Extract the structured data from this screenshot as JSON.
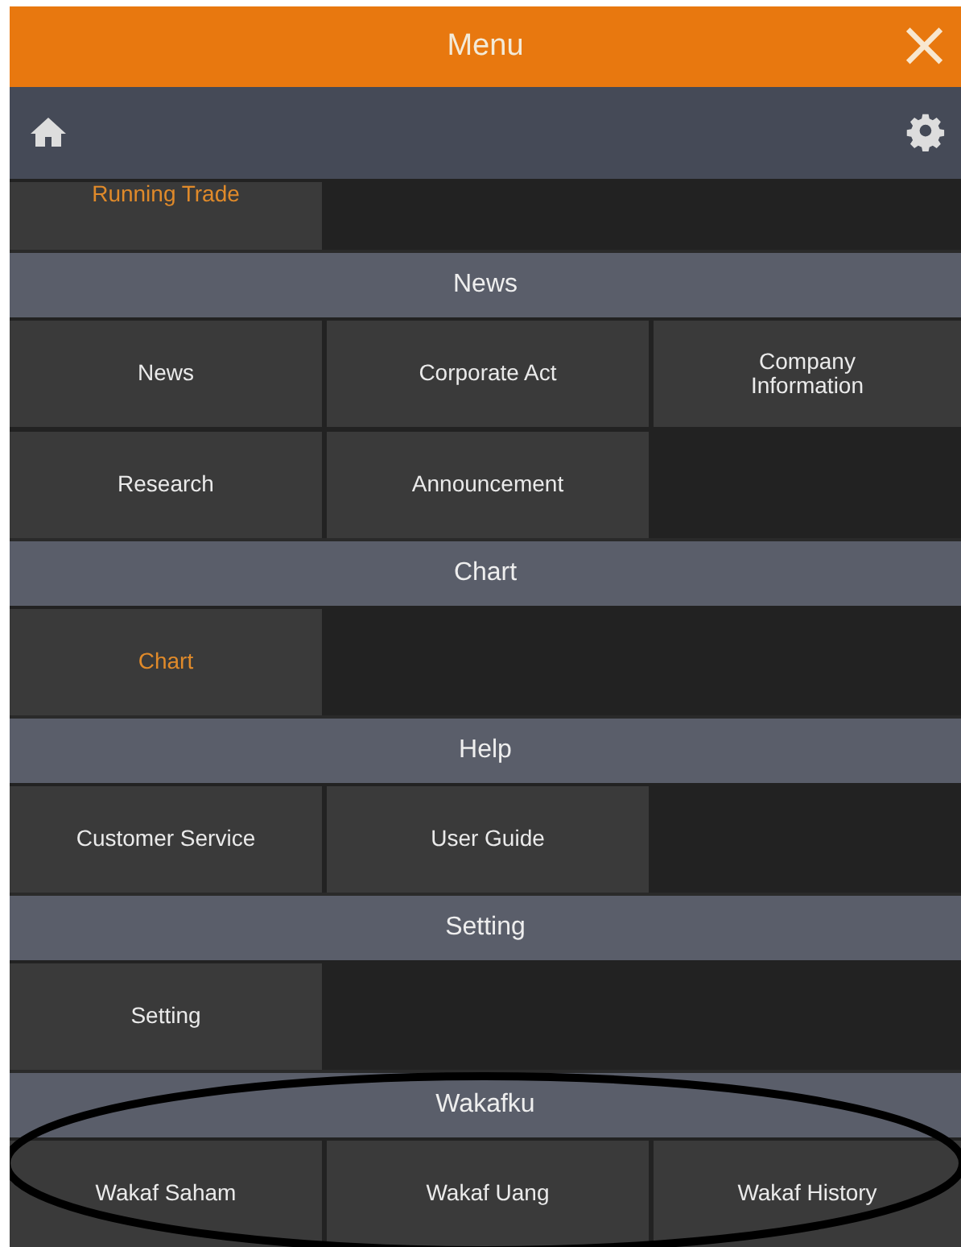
{
  "header": {
    "title": "Menu",
    "close": "×"
  },
  "sections": [
    {
      "circled": false,
      "items": [
        {
          "label": "Running Trade",
          "selected": true
        }
      ]
    },
    {
      "title": "News",
      "circled": false,
      "items": [
        {
          "label": "News",
          "selected": false
        },
        {
          "label": "Corporate Act",
          "selected": false
        },
        {
          "label": "Company Information",
          "selected": false
        },
        {
          "label": "Research",
          "selected": false
        },
        {
          "label": "Announcement",
          "selected": false
        }
      ]
    },
    {
      "title": "Chart",
      "circled": false,
      "items": [
        {
          "label": "Chart",
          "selected": true
        }
      ]
    },
    {
      "title": "Help",
      "circled": false,
      "items": [
        {
          "label": "Customer Service",
          "selected": false
        },
        {
          "label": "User Guide",
          "selected": false
        }
      ]
    },
    {
      "title": "Setting",
      "circled": false,
      "items": [
        {
          "label": "Setting",
          "selected": false
        }
      ]
    },
    {
      "title": "Wakafku",
      "circled": true,
      "items": [
        {
          "label": "Wakaf Saham",
          "selected": false
        },
        {
          "label": "Wakaf Uang",
          "selected": false
        },
        {
          "label": "Wakaf History",
          "selected": false
        }
      ]
    }
  ]
}
